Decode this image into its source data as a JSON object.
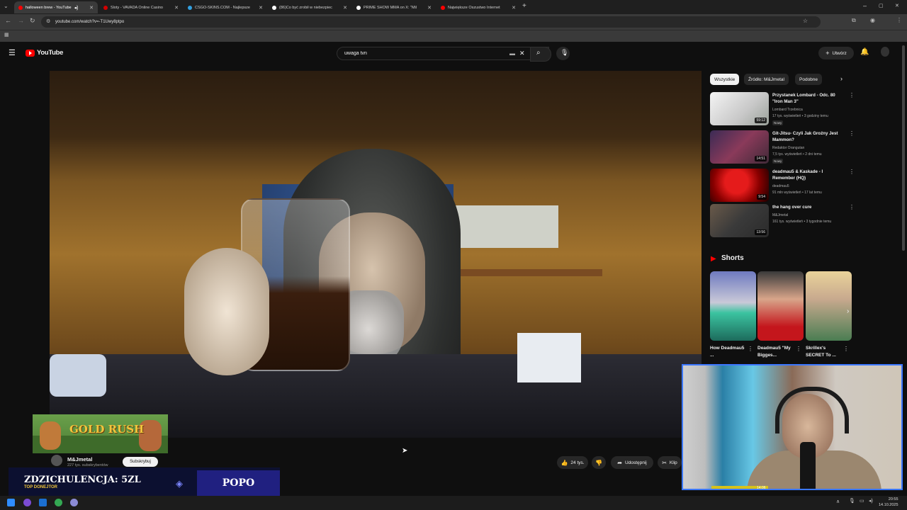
{
  "browser": {
    "tabs": [
      {
        "label": "halloween brew - YouTube",
        "active": true,
        "color": "#ff0000"
      },
      {
        "label": "Sloty - VAVADA Online Casino",
        "active": false,
        "color": "#d40000"
      },
      {
        "label": "CSGO-SKINS.COM - Najlepsze",
        "active": false,
        "color": "#32a0e0"
      },
      {
        "label": "(86)Co być zrobił w niebezpiec",
        "active": false,
        "color": "#ffffff"
      },
      {
        "label": "PRIME SHOW MMA on X: \"Mil",
        "active": false,
        "color": "#ffffff"
      },
      {
        "label": "Największe Oszustwo Internet",
        "active": false,
        "color": "#ff0000"
      }
    ],
    "url": "youtube.com/watch?v=-T1Uwy8ptpo"
  },
  "youtube": {
    "logo": "YouTube",
    "search_value": "uwaga tvn",
    "create_label": "Utwórz"
  },
  "video": {
    "channel": "M&Jmetal",
    "subscribers": "227 tys. subskrybentów",
    "subscribe_label": "Subskrybuj",
    "likes": "24 tys.",
    "share_label": "Udostępnij",
    "clip_label": "Klip"
  },
  "overlay": {
    "gold_rush": "GOLD RUSH",
    "donor_title": "ZDZICHULENCJA: 5ZL",
    "donor_sub": "TOP DONEJTOR",
    "donor_name": "POPO"
  },
  "sidebar": {
    "chips": [
      "Wszystkie",
      "Źródło: M&Jmetal",
      "Podobne"
    ],
    "recs": [
      {
        "title": "Przystanek Lombard - Odc. 80 \"Iron Man 3\"",
        "channel": "Lombard Trzebnica",
        "meta": "17 tys. wyświetleń • 3 godziny temu",
        "badge": "Nowy",
        "duration": "59:12"
      },
      {
        "title": "Git-Jitsu- Czyli Jak Groźny Jest Mammon?",
        "channel": "Redaktor Orangutan",
        "meta": "7,5 tys. wyświetleń • 2 dni temu",
        "badge": "Nowy",
        "duration": "14:51"
      },
      {
        "title": "deadmau5 & Kaskade - I Remember (HQ)",
        "channel": "deadmau5",
        "meta": "91 mln wyświetleń • 17 lat temu",
        "badge": "",
        "duration": "9:54"
      },
      {
        "title": "the hang over cure",
        "channel": "M&Jmetal",
        "meta": "161 tys. wyświetleń • 3 tygodnie temu",
        "badge": "",
        "duration": "13:56"
      }
    ],
    "shorts_heading": "Shorts",
    "shorts": [
      {
        "title": "How Deadmau5 ..."
      },
      {
        "title": "Deadmau5 \"My Bigges..."
      },
      {
        "title": "Skrillex's SECRET To ..."
      }
    ]
  },
  "webcam": {
    "time": "14:06"
  },
  "taskbar": {
    "time": "20:55",
    "date": "14.10.2025"
  }
}
